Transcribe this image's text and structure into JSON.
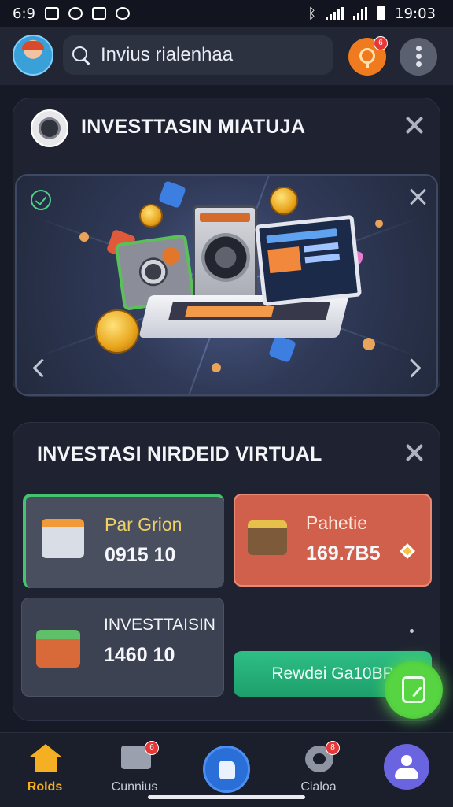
{
  "status_bar": {
    "time_left": "6:9",
    "clock": "19:03"
  },
  "header": {
    "search_text": "Invius rialenhaa",
    "notification_count": "6"
  },
  "investment_card": {
    "title": "INVESTTASIN MIATUJA"
  },
  "virtual_card": {
    "title": "INVESTASI NIRDEID VIRTUAL",
    "tiles": [
      {
        "label": "Par Grion",
        "value": "0915 10",
        "label_color": "#f0d264",
        "bg": "#4a4f60"
      },
      {
        "label": "Pahetie",
        "value": "169.7B5",
        "label_color": "#ffe9dd",
        "bg": "#d0604c"
      },
      {
        "label": "INVESTTAISIN",
        "value": "1460 10",
        "label_color": "#f3f4f8",
        "bg": "#3d4253"
      }
    ],
    "reward_button": "Rewdei Ga10BP"
  },
  "bottom_nav": {
    "items": [
      {
        "label": "Rolds",
        "active": true
      },
      {
        "label": "Cunnius",
        "badge": "6"
      },
      {
        "label": ""
      },
      {
        "label": "Cialoa",
        "badge": "8"
      },
      {
        "label": ""
      }
    ]
  },
  "colors": {
    "accent_green": "#3fc17a",
    "accent_orange": "#f07a1e",
    "nav_active": "#f4b022",
    "tile_red": "#d0604c"
  }
}
